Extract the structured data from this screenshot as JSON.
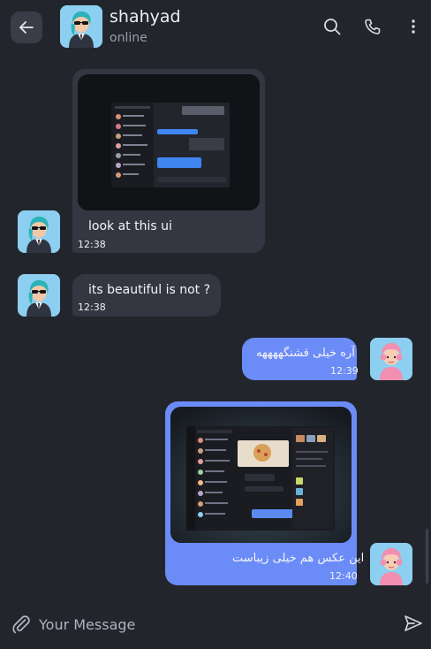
{
  "header": {
    "contact_name": "shahyad",
    "status": "online",
    "back_icon": "arrow-left-icon",
    "search_icon": "search-icon",
    "call_icon": "phone-icon",
    "menu_icon": "kebab-menu-icon"
  },
  "messages": [
    {
      "direction": "in",
      "kind": "image",
      "text": "look at this ui",
      "time": "12:38"
    },
    {
      "direction": "in",
      "kind": "text",
      "text": "its beautiful is not ?",
      "time": "12:38"
    },
    {
      "direction": "out",
      "kind": "text",
      "text": "آره خیلی قشنگههههه",
      "time": "12:39"
    },
    {
      "direction": "out",
      "kind": "image",
      "text": "این عکس هم خیلی زیباست",
      "time": "12:40"
    }
  ],
  "composer": {
    "placeholder": "Your Message",
    "attach_icon": "paperclip-icon",
    "send_icon": "send-icon"
  },
  "colors": {
    "background": "#23252d",
    "incoming_bubble": "#343741",
    "outgoing_bubble": "#6b8bf7"
  }
}
